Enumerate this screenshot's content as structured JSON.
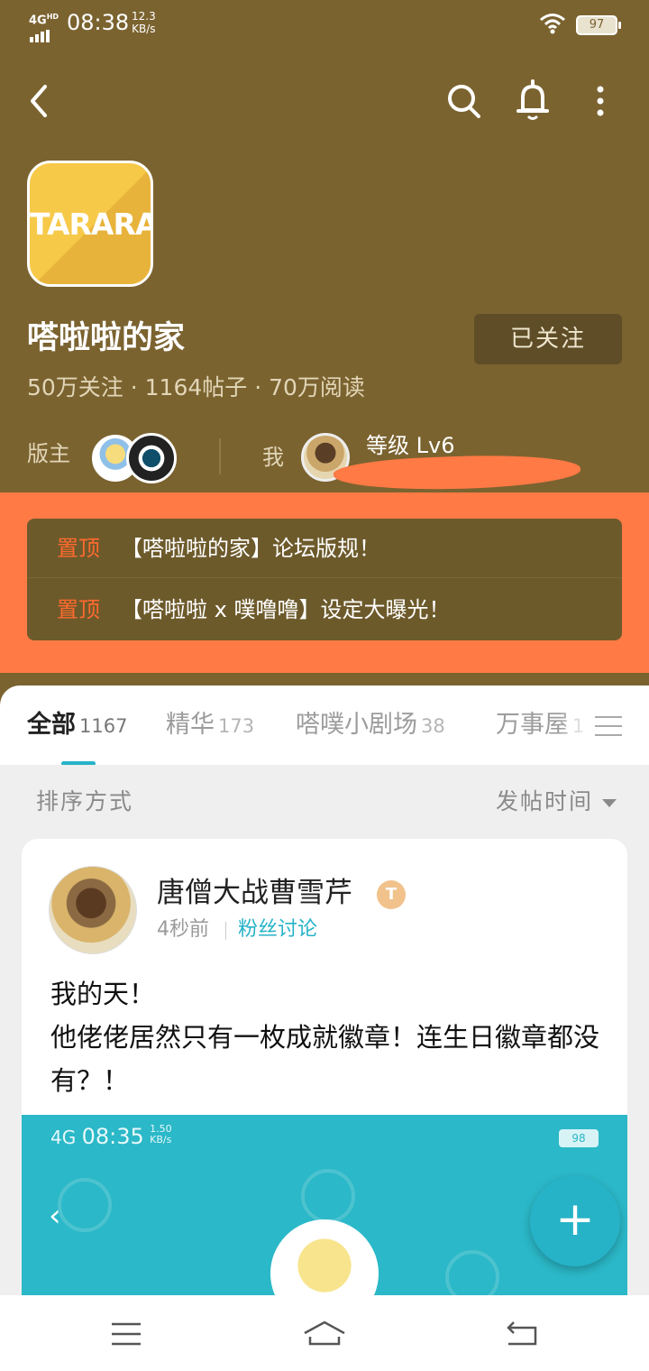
{
  "status_bar": {
    "network": "4G",
    "network_sup": "HD",
    "time": "08:38",
    "speed_value": "12.3",
    "speed_unit": "KB/s",
    "battery": "97"
  },
  "header": {
    "back_icon": "chevron-left-icon",
    "search_icon": "search-icon",
    "bell_icon": "bell-icon",
    "more_icon": "more-vertical-icon"
  },
  "forum": {
    "logo_text": "TARARA",
    "name": "嗒啦啦的家",
    "follow_button": "已关注",
    "stats": "50万关注 · 1164帖子 · 70万阅读",
    "moderator_label": "版主",
    "me_label": "我",
    "level": "等级 Lv6"
  },
  "pinned": [
    {
      "tag": "置顶",
      "title": "【嗒啦啦的家】论坛版规！"
    },
    {
      "tag": "置顶",
      "title": "【嗒啦啦 x 噗噜噜】设定大曝光！"
    }
  ],
  "tabs": [
    {
      "label": "全部",
      "count": "1167"
    },
    {
      "label": "精华",
      "count": "173"
    },
    {
      "label": "嗒噗小剧场",
      "count": "38"
    },
    {
      "label": "万事屋",
      "count": "1"
    }
  ],
  "sort": {
    "label": "排序方式",
    "value": "发帖时间"
  },
  "post": {
    "author": "唐僧大战曹雪芹",
    "badge": "T",
    "time": "4秒前",
    "category": "粉丝讨论",
    "body": "我的天！\n他佬佬居然只有一枚成就徽章！连生日徽章都没有？！",
    "image": {
      "network": "4G",
      "time": "08:35",
      "speed_value": "1.50",
      "speed_unit": "KB/s",
      "battery": "98"
    }
  },
  "fab": {
    "icon": "plus-icon",
    "label": "+"
  },
  "bottom_nav": {
    "menu_icon": "menu-icon",
    "home_icon": "home-icon",
    "back_icon": "back-icon"
  },
  "colors": {
    "header_bg": "#7b6330",
    "highlight": "#ff7a45",
    "accent": "#26b3c7",
    "pin_tag": "#ff6a2e"
  }
}
